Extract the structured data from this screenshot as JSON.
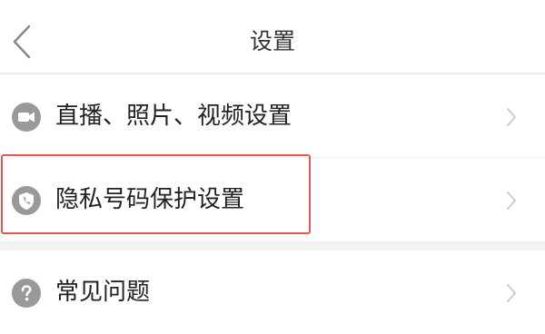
{
  "header": {
    "title": "设置",
    "back_icon": "chevron-left-icon"
  },
  "settings": {
    "items": [
      {
        "label": "直播、照片、视频设置",
        "icon": "video-camera-icon"
      },
      {
        "label": "隐私号码保护设置",
        "icon": "phone-shield-icon"
      },
      {
        "label": "常见问题",
        "icon": "help-question-icon"
      }
    ],
    "row_chevron_icon": "chevron-right-icon"
  },
  "highlight": {
    "target": "隐私号码保护设置",
    "color": "#e05a55"
  },
  "colors": {
    "icon_gray": "#999999",
    "text": "#222222",
    "title_text": "#333333",
    "chevron": "#cccccc",
    "divider": "#ebebeb",
    "background": "#ffffff"
  }
}
